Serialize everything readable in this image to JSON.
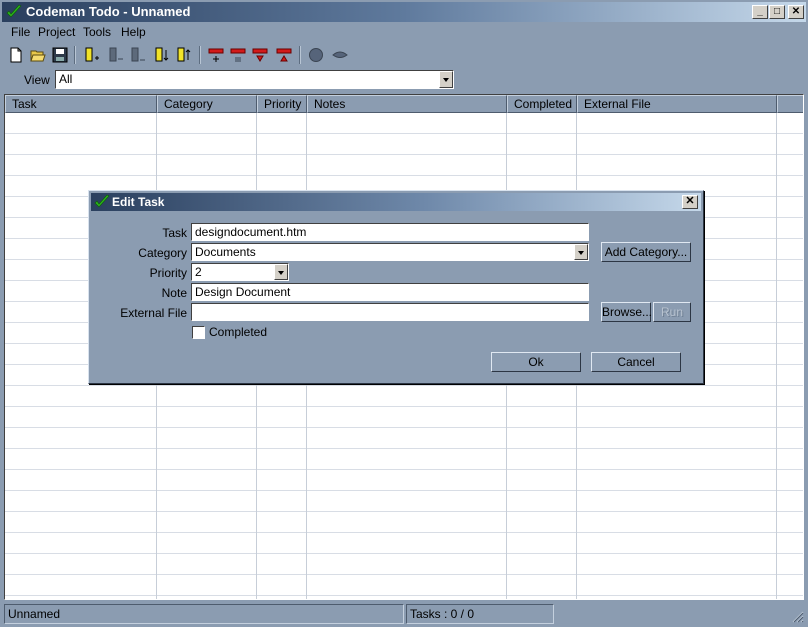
{
  "window": {
    "title": "Codeman Todo - Unnamed",
    "minimize": "_",
    "maximize": "□",
    "close": "✕"
  },
  "menu": {
    "items": [
      "File",
      "Project",
      "Tools",
      "Help"
    ]
  },
  "toolbar": {
    "icons": [
      "new-file-icon",
      "open-folder-icon",
      "save-disk-icon",
      "add-task-icon",
      "task-icon",
      "task-icon",
      "move-down-icon",
      "move-up-icon",
      "add-category-icon",
      "category-icon",
      "category-down-icon",
      "category-up-icon",
      "circle-icon",
      "eye-icon"
    ]
  },
  "view": {
    "label": "View",
    "value": "All"
  },
  "grid": {
    "columns": [
      "Task",
      "Category",
      "Priority",
      "Notes",
      "Completed",
      "External File"
    ]
  },
  "status": {
    "project": "Unnamed",
    "tasks": "Tasks : 0 / 0"
  },
  "dialog": {
    "title": "Edit Task",
    "close": "✕",
    "task_label": "Task",
    "task_value": "designdocument.htm",
    "category_label": "Category",
    "category_value": "Documents",
    "add_category_button": "Add Category...",
    "priority_label": "Priority",
    "priority_value": "2",
    "note_label": "Note",
    "note_value": "Design Document",
    "external_file_label": "External File",
    "external_file_value": "",
    "browse_button": "Browse...",
    "run_button": "Run",
    "completed_label": "Completed",
    "ok_button": "Ok",
    "cancel_button": "Cancel"
  },
  "colors": {
    "background": "#8b9cb1",
    "title_dark": "#2a3f5e",
    "title_light": "#c5d8ea",
    "check_green": "#2bb01c"
  }
}
